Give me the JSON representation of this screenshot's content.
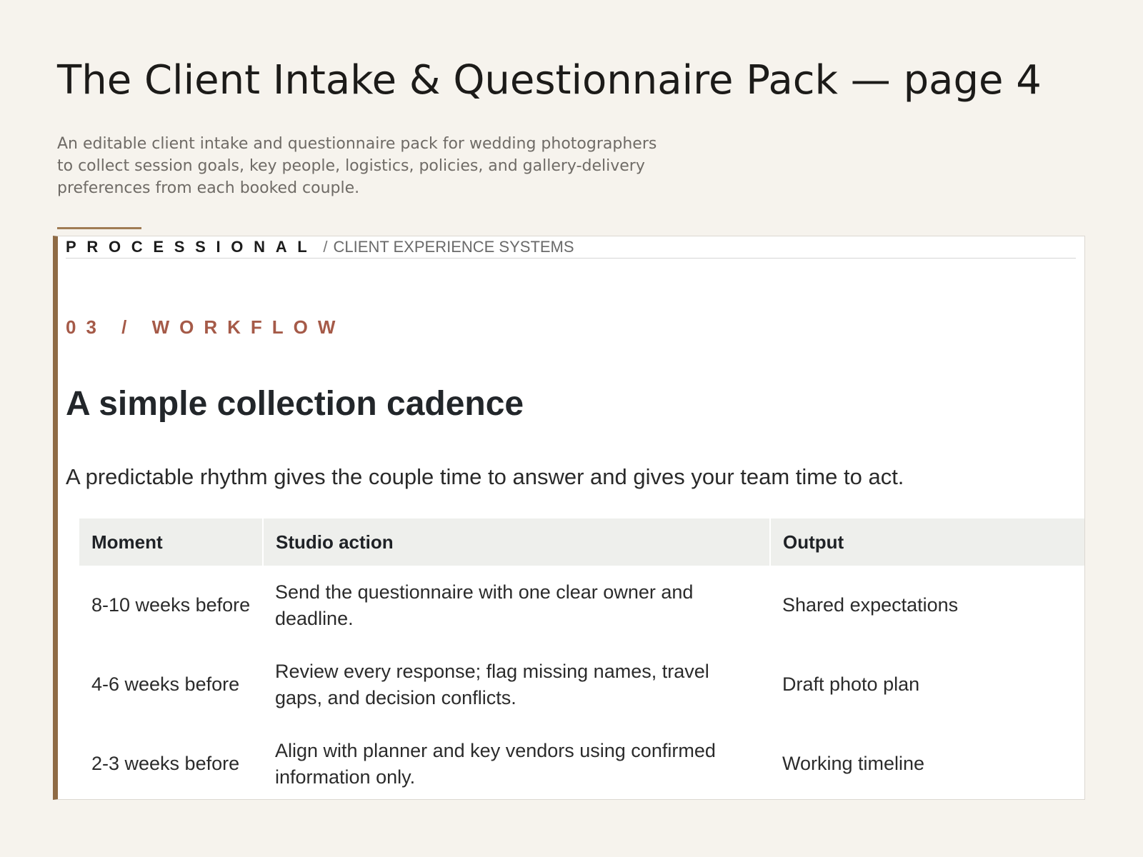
{
  "document": {
    "title": "The Client Intake & Questionnaire Pack — page 4",
    "description": "An editable client intake and questionnaire pack for wedding photographers to collect session goals, key people, logistics, policies, and gallery-delivery preferences from each booked couple."
  },
  "panel": {
    "brand": "PROCESSIONAL",
    "separator": "/",
    "brand_subtitle": "CLIENT EXPERIENCE SYSTEMS",
    "eyebrow": "03 / WORKFLOW",
    "title": "A simple collection cadence",
    "intro": "A predictable rhythm gives the couple time to answer and gives your team time to act.",
    "table": {
      "headers": [
        "Moment",
        "Studio action",
        "Output"
      ],
      "rows": [
        [
          "8-10 weeks before",
          "Send the questionnaire with one clear owner and deadline.",
          "Shared expectations"
        ],
        [
          "4-6 weeks before",
          "Review every response; flag missing names, travel gaps, and decision conflicts.",
          "Draft photo plan"
        ],
        [
          "2-3 weeks before",
          "Align with planner and key vendors using confirmed information only.",
          "Working timeline"
        ]
      ]
    }
  },
  "colors": {
    "page_background": "#f6f3ed",
    "accent_bar": "#8f6b45",
    "accent_rule": "#a07c54",
    "eyebrow": "#a55a48",
    "table_header_bg": "#eeefec"
  }
}
